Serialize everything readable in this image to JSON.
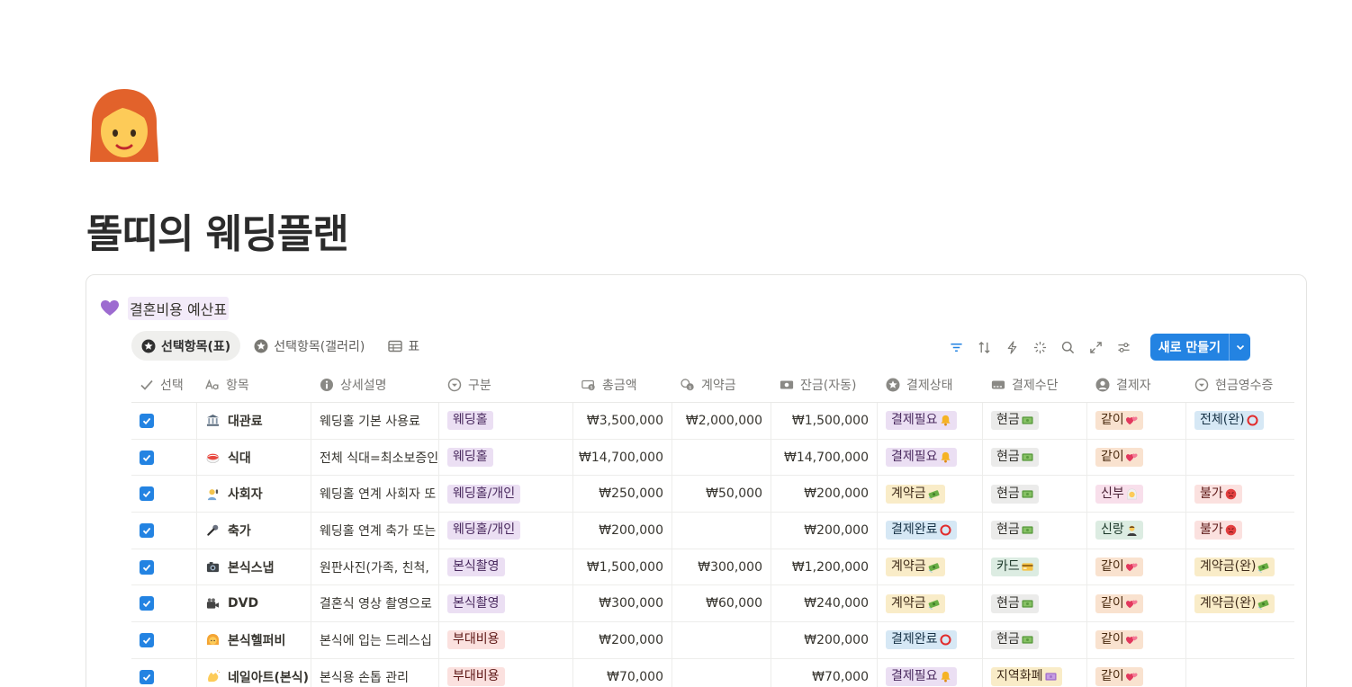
{
  "page": {
    "title": "똘띠의 웨딩플랜",
    "icon": "woman-red-hair-emoji"
  },
  "callout": {
    "icon": "purple-heart-icon",
    "title": "결혼비용 예산표"
  },
  "views": [
    {
      "label": "선택항목(표)",
      "icon": "star-circle-icon",
      "active": true
    },
    {
      "label": "선택항목(갤러리)",
      "icon": "star-circle-icon",
      "active": false
    },
    {
      "label": "표",
      "icon": "table-icon",
      "active": false
    }
  ],
  "toolbar": {
    "icons": [
      "filter-icon",
      "sort-icon",
      "automation-icon",
      "ai-sparkle-icon",
      "search-icon",
      "expand-icon",
      "settings-icon"
    ],
    "new_label": "새로 만들기"
  },
  "columns": [
    {
      "label": "선택",
      "icon": "check-icon"
    },
    {
      "label": "항목",
      "icon": "title-aa-icon"
    },
    {
      "label": "상세설명",
      "icon": "info-icon"
    },
    {
      "label": "구분",
      "icon": "select-icon"
    },
    {
      "label": "총금액",
      "icon": "money-icon"
    },
    {
      "label": "계약금",
      "icon": "coins-icon"
    },
    {
      "label": "잔금(자동)",
      "icon": "bill-icon"
    },
    {
      "label": "결제상태",
      "icon": "star-icon"
    },
    {
      "label": "결제수단",
      "icon": "card-icon"
    },
    {
      "label": "결제자",
      "icon": "person-icon"
    },
    {
      "label": "현금영수증",
      "icon": "select-icon"
    }
  ],
  "rows": [
    {
      "checked": true,
      "emoji": "bank-icon",
      "name": "대관료",
      "desc": "웨딩홀 기본 사용료",
      "category": "웨딩홀",
      "category_color": "purple",
      "total": "₩3,500,000",
      "deposit": "₩2,000,000",
      "balance": "₩1,500,000",
      "status": "결제필요",
      "status_color": "purple",
      "status_icon": "bell-icon",
      "method": "현금",
      "method_color": "gray",
      "method_icon": "cash-icon",
      "payer": "같이",
      "payer_color": "orange",
      "payer_icon": "hearts-icon",
      "receipt": "전체(완)",
      "receipt_color": "blue",
      "receipt_icon": "circle-o-icon"
    },
    {
      "checked": true,
      "emoji": "sushi-icon",
      "name": "식대",
      "desc": "전체 식대=최소보증인",
      "category": "웨딩홀",
      "category_color": "purple",
      "total": "₩14,700,000",
      "deposit": "",
      "balance": "₩14,700,000",
      "status": "결제필요",
      "status_color": "purple",
      "status_icon": "bell-icon",
      "method": "현금",
      "method_color": "gray",
      "method_icon": "cash-icon",
      "payer": "같이",
      "payer_color": "orange",
      "payer_icon": "hearts-icon",
      "receipt": "",
      "receipt_color": "",
      "receipt_icon": ""
    },
    {
      "checked": true,
      "emoji": "mc-icon",
      "name": "사회자",
      "desc": "웨딩홀 연계 사회자 또",
      "category": "웨딩홀/개인",
      "category_color": "purple",
      "total": "₩250,000",
      "deposit": "₩50,000",
      "balance": "₩200,000",
      "status": "계약금",
      "status_color": "yellow",
      "status_icon": "money-wings-icon",
      "method": "현금",
      "method_color": "gray",
      "method_icon": "cash-icon",
      "payer": "신부",
      "payer_color": "pink",
      "payer_icon": "bride-icon",
      "receipt": "불가",
      "receipt_color": "red",
      "receipt_icon": "angry-icon"
    },
    {
      "checked": true,
      "emoji": "mic-icon",
      "name": "축가",
      "desc": "웨딩홀 연계 축가 또는",
      "category": "웨딩홀/개인",
      "category_color": "purple",
      "total": "₩200,000",
      "deposit": "",
      "balance": "₩200,000",
      "status": "결제완료",
      "status_color": "blue",
      "status_icon": "circle-o-icon",
      "method": "현금",
      "method_color": "gray",
      "method_icon": "cash-icon",
      "payer": "신랑",
      "payer_color": "green",
      "payer_icon": "groom-icon",
      "receipt": "불가",
      "receipt_color": "red",
      "receipt_icon": "angry-icon"
    },
    {
      "checked": true,
      "emoji": "camera-icon",
      "name": "본식스냅",
      "desc": "원판사진(가족, 친척,",
      "category": "본식촬영",
      "category_color": "purple",
      "total": "₩1,500,000",
      "deposit": "₩300,000",
      "balance": "₩1,200,000",
      "status": "계약금",
      "status_color": "yellow",
      "status_icon": "money-wings-icon",
      "method": "카드",
      "method_color": "green",
      "method_icon": "card-icon",
      "payer": "같이",
      "payer_color": "orange",
      "payer_icon": "hearts-icon",
      "receipt": "계약금(완)",
      "receipt_color": "yellow",
      "receipt_icon": "money-wings-icon"
    },
    {
      "checked": true,
      "emoji": "video-camera-icon",
      "name": "DVD",
      "desc": "결혼식 영상 촬영으로",
      "category": "본식촬영",
      "category_color": "purple",
      "total": "₩300,000",
      "deposit": "₩60,000",
      "balance": "₩240,000",
      "status": "계약금",
      "status_color": "yellow",
      "status_icon": "money-wings-icon",
      "method": "현금",
      "method_color": "gray",
      "method_icon": "cash-icon",
      "payer": "같이",
      "payer_color": "orange",
      "payer_icon": "hearts-icon",
      "receipt": "계약금(완)",
      "receipt_color": "yellow",
      "receipt_icon": "money-wings-icon"
    },
    {
      "checked": true,
      "emoji": "hair-stylist-icon",
      "name": "본식헬퍼비",
      "desc": "본식에 입는 드레스십",
      "category": "부대비용",
      "category_color": "red",
      "total": "₩200,000",
      "deposit": "",
      "balance": "₩200,000",
      "status": "결제완료",
      "status_color": "blue",
      "status_icon": "circle-o-icon",
      "method": "현금",
      "method_color": "gray",
      "method_icon": "cash-icon",
      "payer": "같이",
      "payer_color": "orange",
      "payer_icon": "hearts-icon",
      "receipt": "",
      "receipt_color": "",
      "receipt_icon": ""
    },
    {
      "checked": true,
      "emoji": "clapping-hands-icon",
      "name": "네일아트(본식)",
      "desc": "본식용 손톱 관리",
      "category": "부대비용",
      "category_color": "red",
      "total": "₩70,000",
      "deposit": "",
      "balance": "₩70,000",
      "status": "결제필요",
      "status_color": "purple",
      "status_icon": "bell-icon",
      "method": "지역화폐",
      "method_color": "yellow",
      "method_icon": "pound-note-icon",
      "payer": "같이",
      "payer_color": "orange",
      "payer_icon": "hearts-icon",
      "receipt": "",
      "receipt_color": "",
      "receipt_icon": ""
    }
  ]
}
